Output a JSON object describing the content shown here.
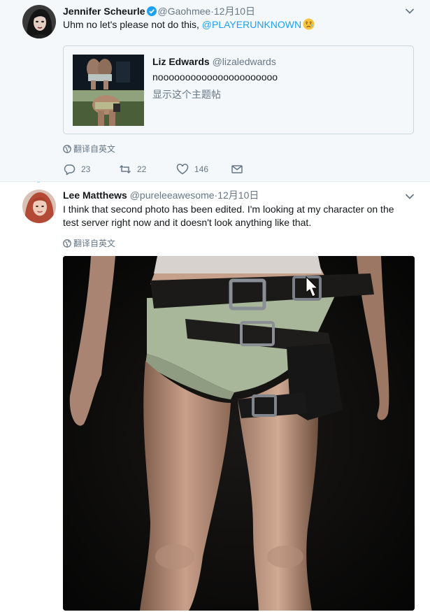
{
  "colors": {
    "thread_line": "#a3dbf2",
    "link": "#1da1f2",
    "muted": "#657786",
    "first_tweet_bg": "#f5f8fa"
  },
  "tweets": [
    {
      "author_name": "Jennifer Scheurle",
      "verified": true,
      "handle": "@Gaohmee",
      "time": "·12月10日",
      "text_before": "Uhm no let's please not do this, ",
      "mention": "@PLAYERUNKNOWN",
      "emoji": "disappointed-relieved-emoji",
      "quote": {
        "name": "Liz Edwards",
        "handle": "@lizaledwards",
        "text": "noooooooooooooooooooooo",
        "show_thread": "显示这个主题帖"
      },
      "translate": "翻译自英文",
      "actions": {
        "replies": "23",
        "retweets": "22",
        "likes": "146"
      }
    },
    {
      "author_name": "Lee Matthews",
      "handle": "@pureleeawesome",
      "time": "·12月10日",
      "text": "I think that second photo has been edited. I'm looking at my character on the test server right now and it doesn't look anything like that.",
      "translate": "翻译自英文",
      "media": "photo of character legs wearing thigh holster"
    }
  ],
  "icons": [
    "chevron-down-icon",
    "verified-icon",
    "globe-icon",
    "reply-icon",
    "retweet-icon",
    "like-icon",
    "dm-icon"
  ]
}
